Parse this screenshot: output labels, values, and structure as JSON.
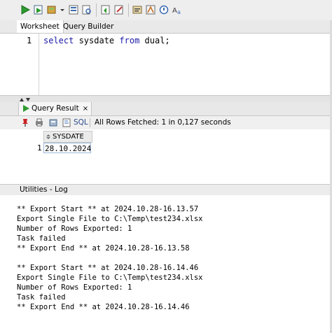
{
  "toolbar": {
    "icons": [
      "run-statement-icon",
      "run-script-icon",
      "commit-icon",
      "chevron-down-icon",
      "sql-tuning-icon",
      "monitor-icon",
      "rollback-icon",
      "clear-icon",
      "autotrace-icon",
      "explain-plan-icon",
      "unshared-sql-icon",
      "format-icon"
    ]
  },
  "editor_tabs": [
    "Worksheet",
    "Query Builder"
  ],
  "editor": {
    "line_number": "1",
    "code": {
      "kw1": "select",
      "plain1": " sysdate ",
      "kw2": "from",
      "plain2": " dual;"
    }
  },
  "result": {
    "tab_label": "Query Result",
    "tab_close": "×",
    "sql_label": "SQL",
    "status": "All Rows Fetched: 1 in 0,127 seconds",
    "columns": [
      "SYSDATE"
    ],
    "rows": [
      {
        "num": "1",
        "values": [
          "28.10.2024"
        ]
      }
    ]
  },
  "log": {
    "title": "Utilities - Log",
    "lines": [
      "** Export Start ** at 2024.10.28-16.13.57",
      "Export Single File to C:\\Temp\\test234.xlsx",
      "Number of Rows Exported: 1",
      "Task failed",
      "** Export End ** at 2024.10.28-16.13.58",
      "",
      "** Export Start ** at 2024.10.28-16.14.46",
      "Export Single File to C:\\Temp\\test234.xlsx",
      "Number of Rows Exported: 1",
      "Task failed",
      "** Export End ** at 2024.10.28-16.14.46"
    ]
  },
  "colors": {
    "keyword": "#1a1aa6",
    "run_green": "#2e9a2e",
    "pin_red": "#cc2222"
  }
}
